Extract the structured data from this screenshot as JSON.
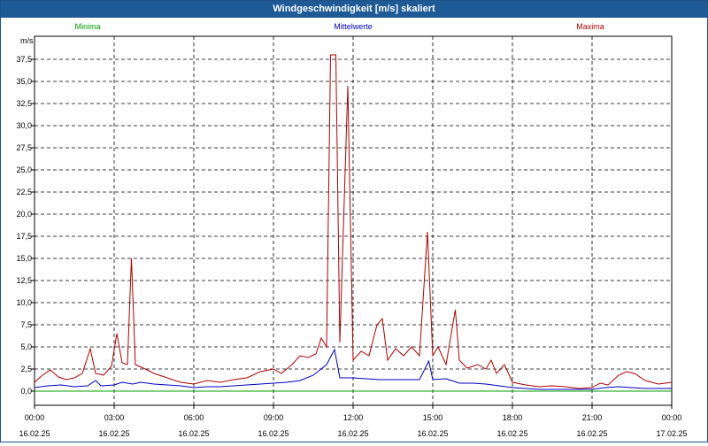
{
  "window": {
    "title": "Windgeschwindigkeit [m/s] skaliert"
  },
  "chart_data": {
    "type": "line",
    "title": "Windgeschwindigkeit [m/s] skaliert",
    "ylabel": "m/s",
    "xlabel": "",
    "ylim": [
      0,
      40
    ],
    "xlim": [
      0,
      24
    ],
    "grid": true,
    "legend_position": "top",
    "y_ticks": [
      "0,0",
      "2,5",
      "5,0",
      "7,5",
      "10,0",
      "12,5",
      "15,0",
      "17,5",
      "20,0",
      "22,5",
      "25,0",
      "27,5",
      "30,0",
      "32,5",
      "35,0",
      "37,5"
    ],
    "x_ticks": [
      {
        "time": "00:00",
        "date": "16.02.25"
      },
      {
        "time": "03:00",
        "date": "16.02.25"
      },
      {
        "time": "06:00",
        "date": "16.02.25"
      },
      {
        "time": "09:00",
        "date": "16.02.25"
      },
      {
        "time": "12:00",
        "date": "16.02.25"
      },
      {
        "time": "15:00",
        "date": "16.02.25"
      },
      {
        "time": "18:00",
        "date": "16.02.25"
      },
      {
        "time": "21:00",
        "date": "16.02.25"
      },
      {
        "time": "00:00",
        "date": "17.02.25"
      }
    ],
    "series": [
      {
        "name": "Minima",
        "color": "#00a000",
        "points": [
          [
            0,
            0
          ],
          [
            24,
            0
          ]
        ]
      },
      {
        "name": "Mittelwerte",
        "color": "#0000c8",
        "points": [
          [
            0,
            0.4
          ],
          [
            0.5,
            0.6
          ],
          [
            1,
            0.7
          ],
          [
            1.5,
            0.5
          ],
          [
            2,
            0.6
          ],
          [
            2.3,
            1.2
          ],
          [
            2.5,
            0.6
          ],
          [
            3,
            0.7
          ],
          [
            3.3,
            1.0
          ],
          [
            3.7,
            0.8
          ],
          [
            4,
            1.0
          ],
          [
            4.5,
            0.8
          ],
          [
            5,
            0.7
          ],
          [
            5.5,
            0.6
          ],
          [
            6,
            0.4
          ],
          [
            6.5,
            0.5
          ],
          [
            7,
            0.5
          ],
          [
            7.5,
            0.6
          ],
          [
            8,
            0.7
          ],
          [
            8.5,
            0.8
          ],
          [
            9,
            0.9
          ],
          [
            9.5,
            1.0
          ],
          [
            10,
            1.2
          ],
          [
            10.5,
            1.8
          ],
          [
            11,
            3.0
          ],
          [
            11.3,
            4.7
          ],
          [
            11.5,
            1.5
          ],
          [
            12,
            1.5
          ],
          [
            12.5,
            1.4
          ],
          [
            13,
            1.3
          ],
          [
            13.5,
            1.3
          ],
          [
            14,
            1.3
          ],
          [
            14.5,
            1.3
          ],
          [
            14.85,
            3.4
          ],
          [
            15,
            1.3
          ],
          [
            15.5,
            1.4
          ],
          [
            16,
            0.9
          ],
          [
            16.5,
            0.9
          ],
          [
            17,
            0.8
          ],
          [
            17.5,
            0.6
          ],
          [
            18,
            0.4
          ],
          [
            19,
            0.2
          ],
          [
            20,
            0.2
          ],
          [
            21,
            0.2
          ],
          [
            21.5,
            0.4
          ],
          [
            22,
            0.5
          ],
          [
            22.5,
            0.4
          ],
          [
            23,
            0.3
          ],
          [
            24,
            0.3
          ]
        ]
      },
      {
        "name": "Maxima",
        "color": "#b00000",
        "points": [
          [
            0,
            1.0
          ],
          [
            0.3,
            1.8
          ],
          [
            0.6,
            2.4
          ],
          [
            0.9,
            1.6
          ],
          [
            1.2,
            1.3
          ],
          [
            1.5,
            1.5
          ],
          [
            1.8,
            2.0
          ],
          [
            2.1,
            4.8
          ],
          [
            2.3,
            2.0
          ],
          [
            2.6,
            1.8
          ],
          [
            2.9,
            2.8
          ],
          [
            3.1,
            6.5
          ],
          [
            3.3,
            3.2
          ],
          [
            3.5,
            3.0
          ],
          [
            3.65,
            15.0
          ],
          [
            3.8,
            3.0
          ],
          [
            4.1,
            2.6
          ],
          [
            4.5,
            2.0
          ],
          [
            5.0,
            1.5
          ],
          [
            5.5,
            1.0
          ],
          [
            6.0,
            0.8
          ],
          [
            6.5,
            1.2
          ],
          [
            7.0,
            1.0
          ],
          [
            7.5,
            1.3
          ],
          [
            8.0,
            1.5
          ],
          [
            8.5,
            2.2
          ],
          [
            9.0,
            2.5
          ],
          [
            9.3,
            2.0
          ],
          [
            9.7,
            3.0
          ],
          [
            10.0,
            4.0
          ],
          [
            10.3,
            3.8
          ],
          [
            10.6,
            4.2
          ],
          [
            10.8,
            6.0
          ],
          [
            11.0,
            5.0
          ],
          [
            11.15,
            38.0
          ],
          [
            11.35,
            38.0
          ],
          [
            11.5,
            5.5
          ],
          [
            11.8,
            34.5
          ],
          [
            12.0,
            3.5
          ],
          [
            12.3,
            4.5
          ],
          [
            12.6,
            4.0
          ],
          [
            12.9,
            7.5
          ],
          [
            13.1,
            8.2
          ],
          [
            13.3,
            3.5
          ],
          [
            13.6,
            4.8
          ],
          [
            13.9,
            4.0
          ],
          [
            14.2,
            5.0
          ],
          [
            14.5,
            4.0
          ],
          [
            14.8,
            18.0
          ],
          [
            15.0,
            4.0
          ],
          [
            15.2,
            5.0
          ],
          [
            15.5,
            3.0
          ],
          [
            15.85,
            9.2
          ],
          [
            16.0,
            3.5
          ],
          [
            16.3,
            2.6
          ],
          [
            16.7,
            3.0
          ],
          [
            17.0,
            2.5
          ],
          [
            17.2,
            3.5
          ],
          [
            17.4,
            2.0
          ],
          [
            17.7,
            3.0
          ],
          [
            18.0,
            1.0
          ],
          [
            18.5,
            0.7
          ],
          [
            19.0,
            0.5
          ],
          [
            19.5,
            0.6
          ],
          [
            20.0,
            0.5
          ],
          [
            20.5,
            0.3
          ],
          [
            21.0,
            0.4
          ],
          [
            21.3,
            0.9
          ],
          [
            21.6,
            0.7
          ],
          [
            22.0,
            1.8
          ],
          [
            22.3,
            2.2
          ],
          [
            22.6,
            2.0
          ],
          [
            23.0,
            1.2
          ],
          [
            23.5,
            0.8
          ],
          [
            24.0,
            1.0
          ]
        ]
      }
    ]
  }
}
